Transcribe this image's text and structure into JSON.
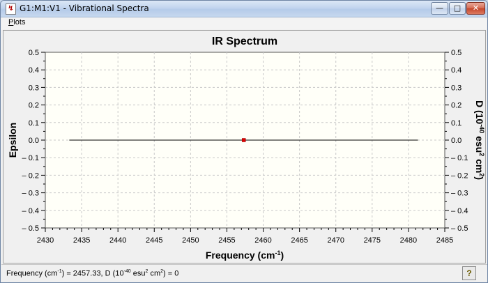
{
  "window": {
    "title": "G1:M1:V1 - Vibrational Spectra",
    "minimize_glyph": "—",
    "maximize_glyph": "□",
    "close_glyph": "✕",
    "icon": "spectrum-app-icon"
  },
  "menu": {
    "items": [
      {
        "label": "Plots",
        "accel": "P"
      }
    ]
  },
  "status": {
    "freq_label": "Frequency (cm",
    "freq_sup": "-1",
    "freq_tail": ") = 2457.33, D (10",
    "d_sup": "-40",
    "d_mid": " esu",
    "d_sup2": "2",
    "d_mid2": " cm",
    "d_sup3": "2",
    "d_tail": ") = 0",
    "help_glyph": "?"
  },
  "colors": {
    "plot_bg": "#fffff8",
    "grid": "#c8c8c8",
    "line": "#000000",
    "marker": "#e00000"
  },
  "chart_data": {
    "type": "line",
    "title": "IR Spectrum",
    "xlabel": "Frequency (cm-1)",
    "ylabel": "Epsilon",
    "y2label": "D (10-40 esu2 cm2)",
    "xlim": [
      2430,
      2485
    ],
    "ylim": [
      -0.5,
      0.5
    ],
    "x_ticks": [
      2430,
      2435,
      2440,
      2445,
      2450,
      2455,
      2460,
      2465,
      2470,
      2475,
      2480,
      2485
    ],
    "y_ticks": [
      -0.5,
      -0.4,
      -0.3,
      -0.2,
      -0.1,
      0.0,
      0.1,
      0.2,
      0.3,
      0.4,
      0.5
    ],
    "y_tick_labels": [
      "– 0.5",
      "– 0.4",
      "– 0.3",
      "– 0.2",
      "– 0.1",
      "0.0",
      "0.1",
      "0.2",
      "0.3",
      "0.4",
      "0.5"
    ],
    "grid": true,
    "series": [
      {
        "x": [
          2433.3,
          2481.3
        ],
        "y": [
          0,
          0
        ]
      }
    ],
    "marker": {
      "x": 2457.33,
      "y": 0
    }
  }
}
